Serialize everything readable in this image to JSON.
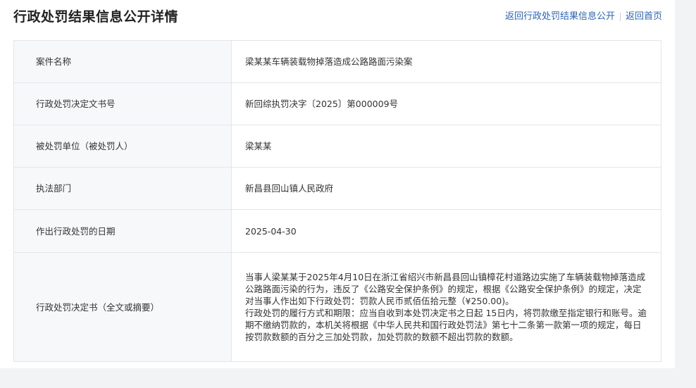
{
  "header": {
    "title": "行政处罚结果信息公开详情",
    "link_back_list": "返回行政处罚结果信息公开",
    "link_home": "返回首页"
  },
  "rows": [
    {
      "label": "案件名称",
      "value": "梁某某车辆装载物掉落造成公路路面污染案"
    },
    {
      "label": "行政处罚决定文书号",
      "value": "新回综执罚决字〔2025〕第000009号"
    },
    {
      "label": "被处罚单位（被处罚人）",
      "value": "梁某某"
    },
    {
      "label": "执法部门",
      "value": "新昌县回山镇人民政府"
    },
    {
      "label": "作出行政处罚的日期",
      "value": "2025-04-30"
    },
    {
      "label": "行政处罚决定书（全文或摘要）",
      "paragraphs": [
        "当事人梁某某于2025年4月10日在浙江省绍兴市新昌县回山镇樟花村道路边实施了车辆装载物掉落造成公路路面污染的行为，违反了《公路安全保护条例》的规定，根据《公路安全保护条例》的规定，决定对当事人作出如下行政处罚：罚款人民币贰佰伍拾元整（¥250.00)。",
        "行政处罚的履行方式和期限：应当自收到本处罚决定书之日起 15日内，将罚款缴至指定银行和账号。逾期不缴纳罚款的，本机关将根据《中华人民共和国行政处罚法》第七十二条第一款第一项的规定，每日按罚款数额的百分之三加处罚款，加处罚款的数额不超出罚款的数额。"
      ]
    }
  ]
}
